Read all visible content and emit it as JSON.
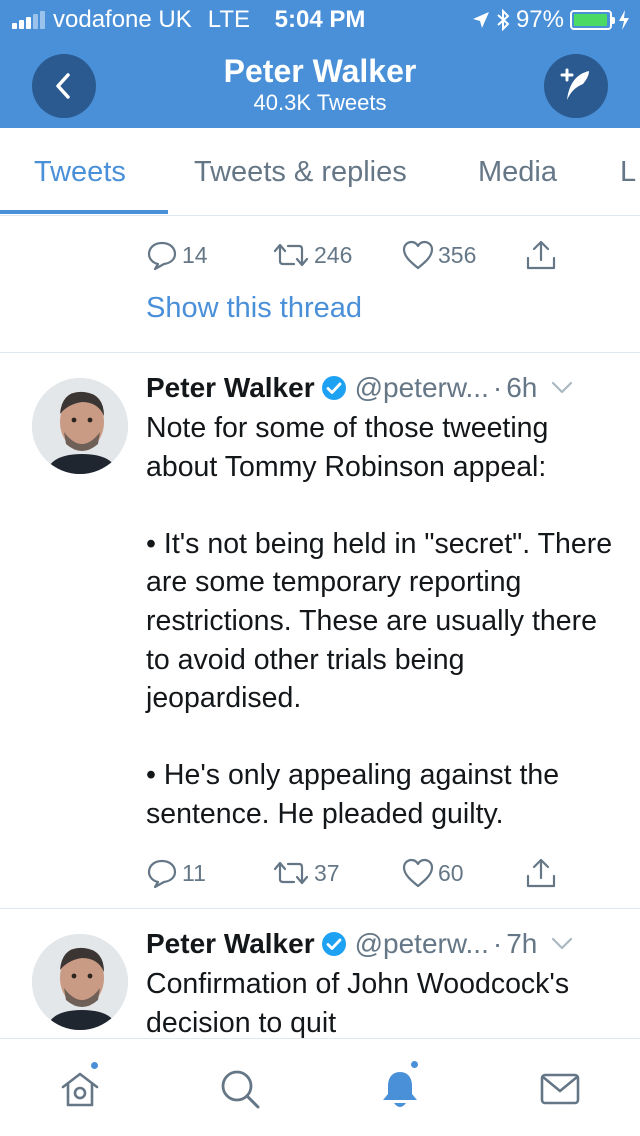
{
  "status_bar": {
    "carrier": "vodafone UK",
    "network": "LTE",
    "time": "5:04 PM",
    "battery": "97%",
    "battery_level": 0.97,
    "signal_bars": 3
  },
  "header": {
    "title": "Peter Walker",
    "subtitle": "40.3K Tweets",
    "back_icon": "chevron-left-icon",
    "compose_icon": "compose-tweet-icon",
    "color": "#4a90d9"
  },
  "tabs": [
    {
      "label": "Tweets",
      "active": true
    },
    {
      "label": "Tweets & replies",
      "active": false
    },
    {
      "label": "Media",
      "active": false
    },
    {
      "label": "L",
      "active": false
    }
  ],
  "first_tweet_actions": {
    "replies": "14",
    "retweets": "246",
    "likes": "356"
  },
  "show_thread": "Show this thread",
  "tweets": [
    {
      "name": "Peter Walker",
      "handle": "@peterw...",
      "dot": "·",
      "time": "6h",
      "body": "Note for some of those tweeting about Tommy Robinson appeal:\n\n• It's not being held in \"secret\". There are some temporary reporting restrictions. These are usually there to avoid other trials being jeopardised.\n\n• He's only appealing against the sentence. He pleaded guilty.",
      "replies": "11",
      "retweets": "37",
      "likes": "60"
    },
    {
      "name": "Peter Walker",
      "handle": "@peterw...",
      "dot": "·",
      "time": "7h",
      "body": "Confirmation of John Woodcock's decision to quit"
    }
  ],
  "tab_bar": [
    {
      "icon": "home-icon",
      "badge": true
    },
    {
      "icon": "search-icon",
      "badge": false
    },
    {
      "icon": "notifications-bell-icon",
      "badge": true
    },
    {
      "icon": "messages-envelope-icon",
      "badge": false
    }
  ],
  "colors": {
    "accent": "#4a90d9",
    "verified": "#1da1f2",
    "muted_text": "#657786",
    "battery": "#4cd964"
  }
}
